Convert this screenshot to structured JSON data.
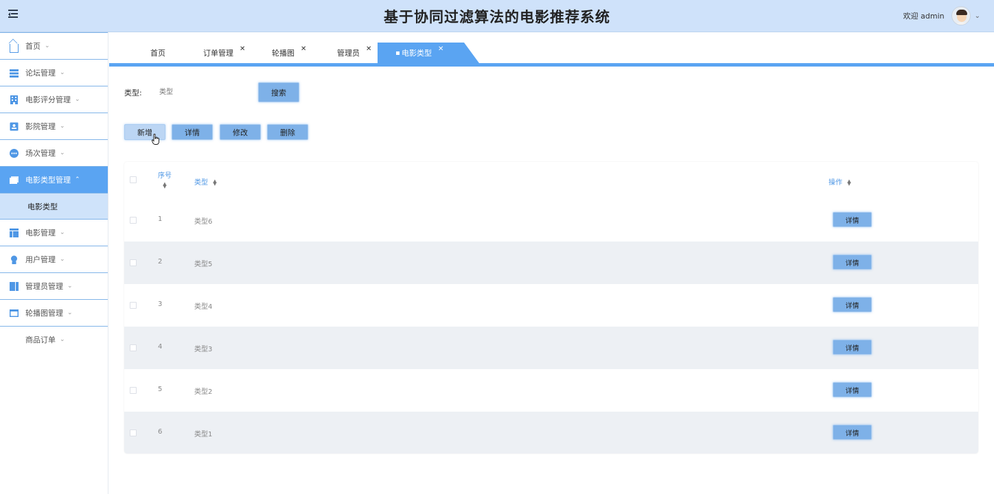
{
  "header": {
    "title": "基于协同过滤算法的电影推荐系统",
    "welcome": "欢迎 admin",
    "menu_icon": "menu-fold-icon",
    "dropdown_icon": "chevron-down-icon"
  },
  "sidebar": {
    "items": [
      {
        "label": "首页",
        "icon": "home-icon"
      },
      {
        "label": "论坛管理",
        "icon": "list-icon"
      },
      {
        "label": "电影评分管理",
        "icon": "building-icon"
      },
      {
        "label": "影院管理",
        "icon": "contact-icon"
      },
      {
        "label": "场次管理",
        "icon": "more-circle-icon"
      },
      {
        "label": "电影类型管理",
        "icon": "folder-icon",
        "active": true,
        "children": [
          {
            "label": "电影类型"
          }
        ]
      },
      {
        "label": "电影管理",
        "icon": "layout-icon"
      },
      {
        "label": "用户管理",
        "icon": "user-badge-icon"
      },
      {
        "label": "管理员管理",
        "icon": "book-icon"
      },
      {
        "label": "轮播图管理",
        "icon": "window-icon"
      },
      {
        "label": "商品订单",
        "icon": ""
      }
    ]
  },
  "tabs": [
    {
      "label": "首页",
      "closable": false
    },
    {
      "label": "订单管理",
      "closable": true
    },
    {
      "label": "轮播图",
      "closable": true
    },
    {
      "label": "管理员",
      "closable": true
    },
    {
      "label": "电影类型",
      "closable": true,
      "active": true
    }
  ],
  "search": {
    "label": "类型:",
    "placeholder": "类型",
    "button": "搜索"
  },
  "actions": {
    "add": "新增",
    "detail": "详情",
    "edit": "修改",
    "delete": "删除"
  },
  "table": {
    "columns": {
      "no": "序号",
      "type": "类型",
      "op": "操作"
    },
    "rows": [
      {
        "no": "1",
        "type": "类型6",
        "action": "详情"
      },
      {
        "no": "2",
        "type": "类型5",
        "action": "详情"
      },
      {
        "no": "3",
        "type": "类型4",
        "action": "详情"
      },
      {
        "no": "4",
        "type": "类型3",
        "action": "详情"
      },
      {
        "no": "5",
        "type": "类型2",
        "action": "详情"
      },
      {
        "no": "6",
        "type": "类型1",
        "action": "详情"
      }
    ]
  },
  "colors": {
    "accent": "#5aa4f2",
    "header_bg": "#cfe2fa",
    "button_bg": "#7eb1e8",
    "row_alt": "#edf0f4"
  }
}
